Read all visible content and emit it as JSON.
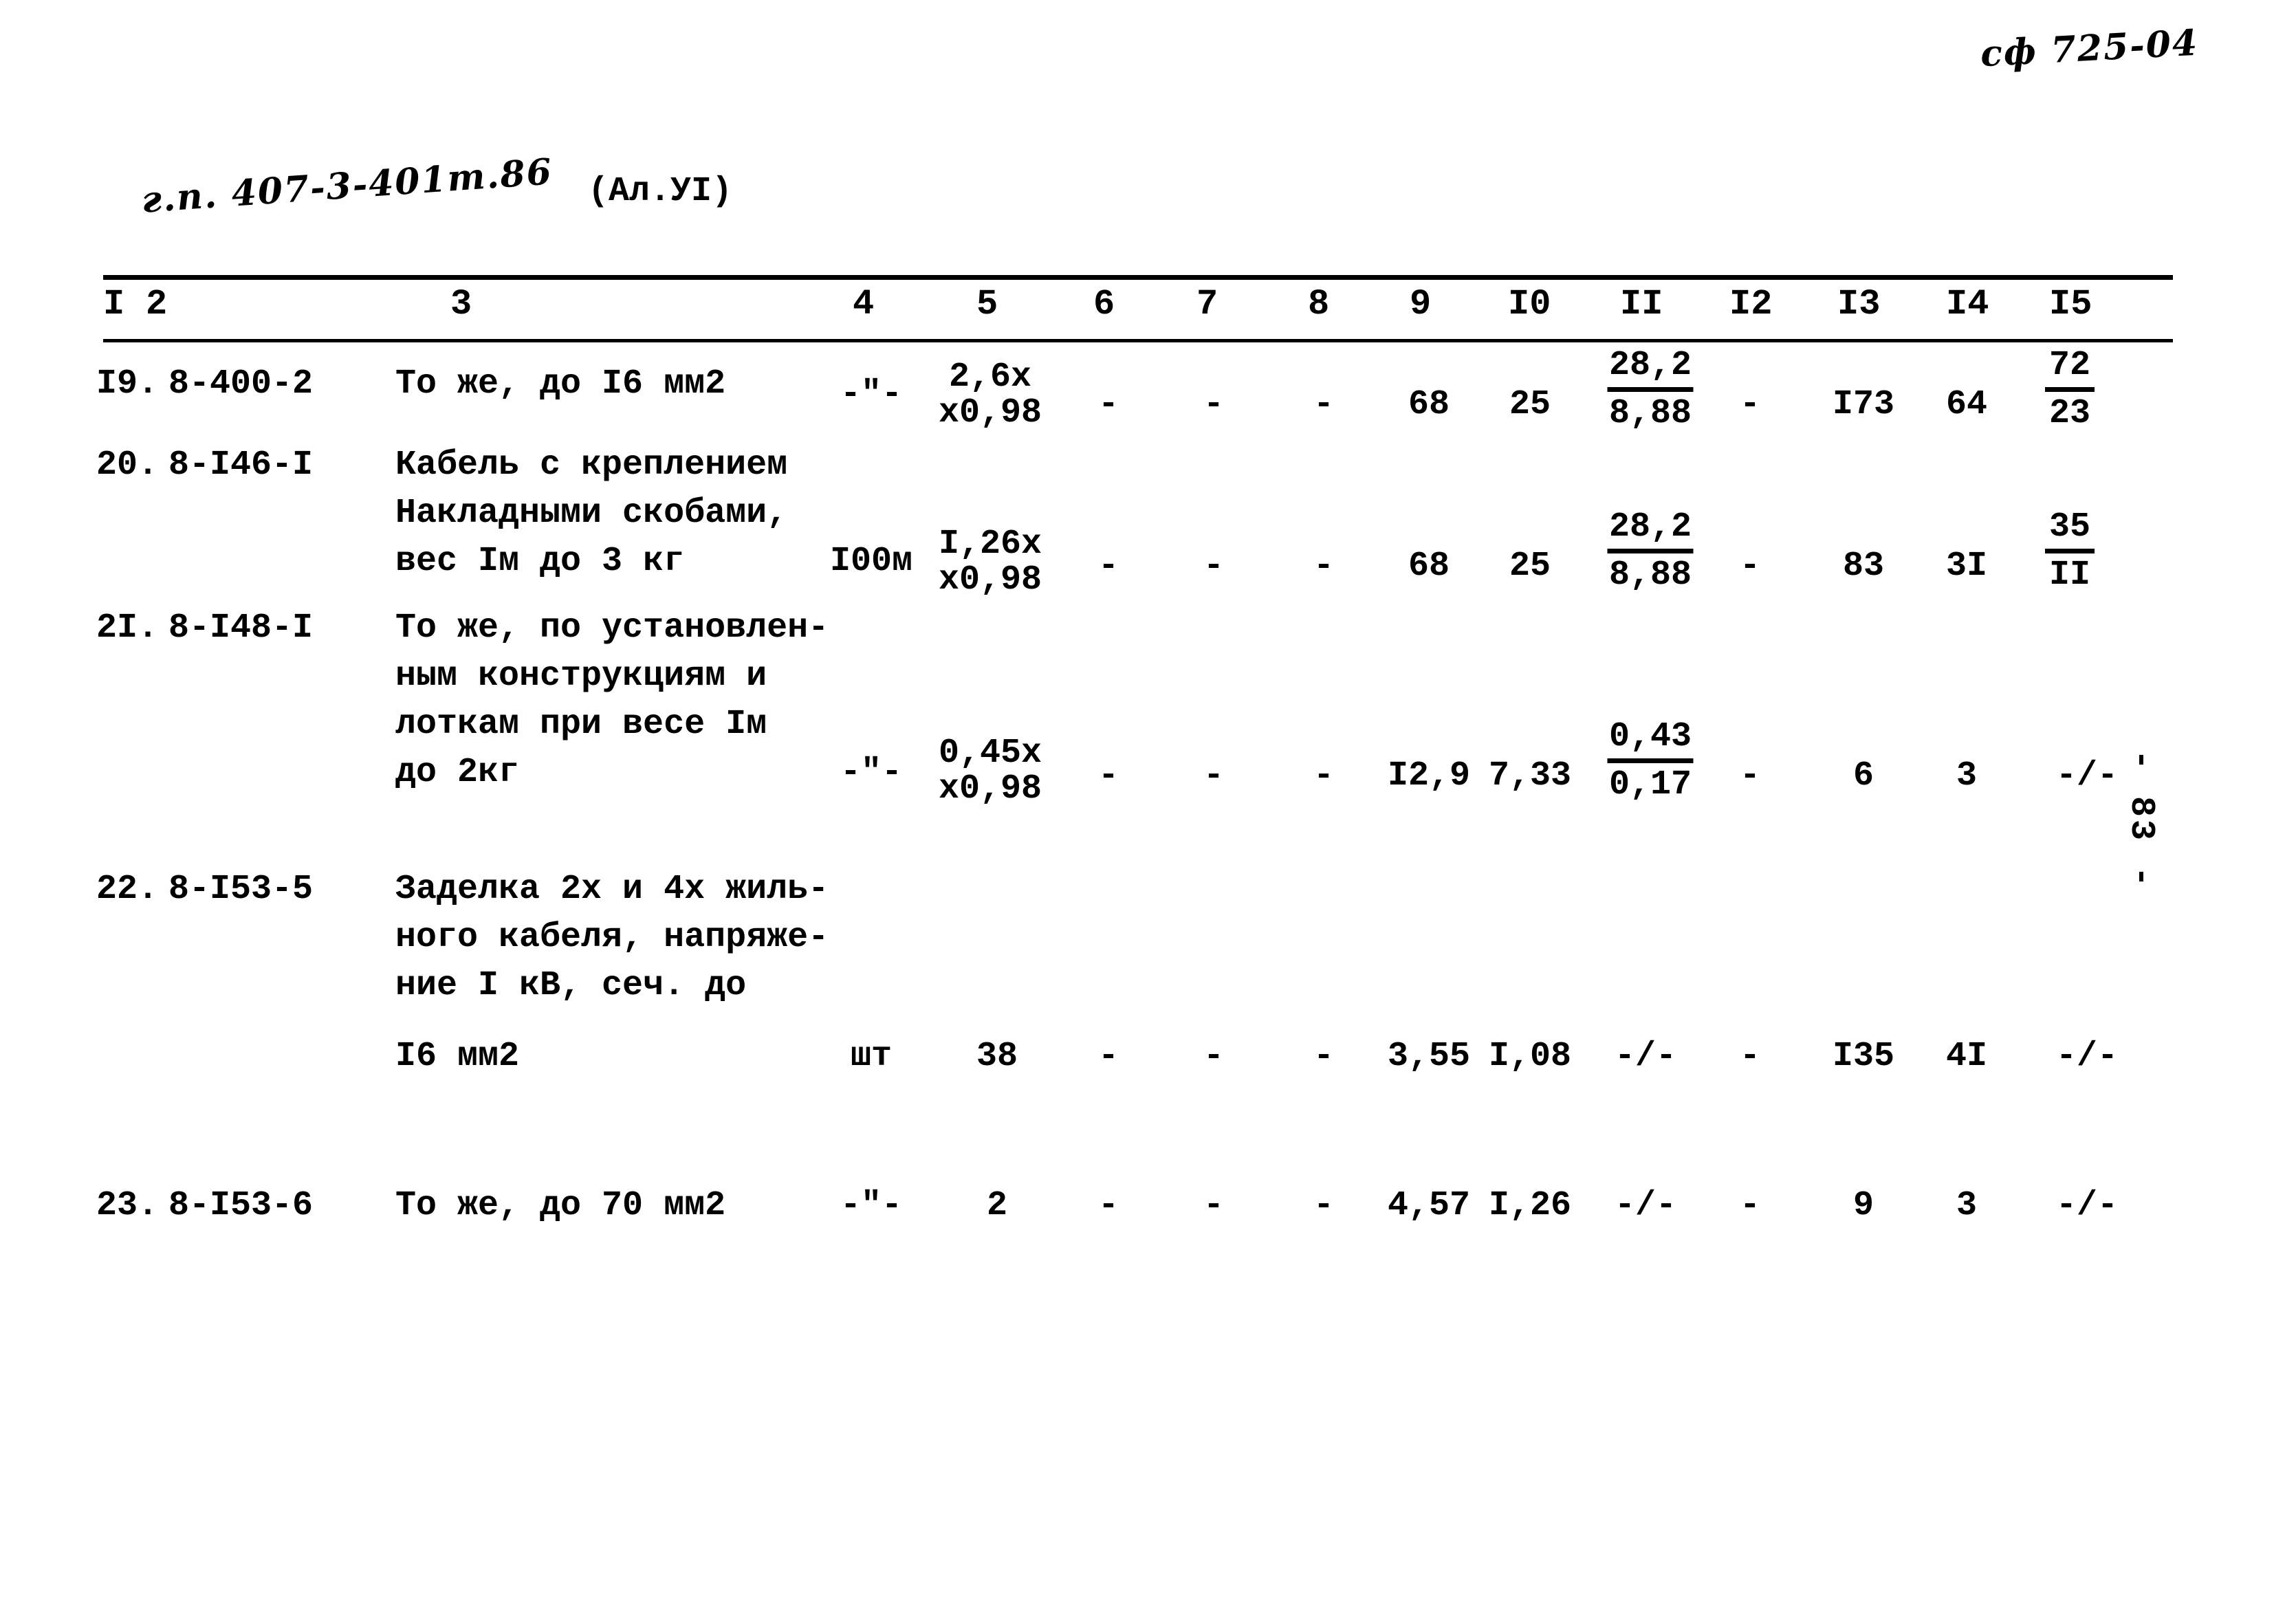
{
  "annotations": {
    "top_right_code": "сф 725-04",
    "project_code": "г.п. 407-3-401т.86",
    "album_label": "(Ал.УI)",
    "page_marker": "- 83 -"
  },
  "table": {
    "column_headers": [
      "I",
      "2",
      "3",
      "4",
      "5",
      "6",
      "7",
      "8",
      "9",
      "I0",
      "II",
      "I2",
      "I3",
      "I4",
      "I5"
    ],
    "rows": [
      {
        "no": "I9.",
        "code": "8-400-2",
        "description": [
          "То же, до I6 мм2"
        ],
        "unit": "-\"-",
        "qty_top": "2,6х",
        "qty_bottom": "х0,98",
        "c6": "-",
        "c7": "-",
        "c8": "-",
        "c9": "68",
        "c10": "25",
        "c11_num": "28,2",
        "c11_den": "8,88",
        "c12": "-",
        "c13": "I73",
        "c14": "64",
        "c15_num": "72",
        "c15_den": "23"
      },
      {
        "no": "20.",
        "code": "8-I46-I",
        "description": [
          "Кабель с креплением",
          "Накладными скобами,",
          "вес Iм до 3 кг"
        ],
        "unit": "I00м",
        "qty_top": "I,26х",
        "qty_bottom": "х0,98",
        "c6": "-",
        "c7": "-",
        "c8": "-",
        "c9": "68",
        "c10": "25",
        "c11_num": "28,2",
        "c11_den": "8,88",
        "c12": "-",
        "c13": "83",
        "c14": "3I",
        "c15_num": "35",
        "c15_den": "II"
      },
      {
        "no": "2I.",
        "code": "8-I48-I",
        "description": [
          "То же, по установлен-",
          "ным конструкциям и",
          "лоткам при весе Iм",
          "до 2кг"
        ],
        "unit": "-\"-",
        "qty_top": "0,45х",
        "qty_bottom": "х0,98",
        "c6": "-",
        "c7": "-",
        "c8": "-",
        "c9": "I2,9",
        "c10": "7,33",
        "c11_num": "0,43",
        "c11_den": "0,17",
        "c12": "-",
        "c13": "6",
        "c14": "3",
        "c15": "-/-"
      },
      {
        "no": "22.",
        "code": "8-I53-5",
        "description": [
          "Заделка 2х и 4х жиль-",
          "ного кабеля, напряже-",
          "ние I кВ, сеч. до",
          "I6 мм2"
        ],
        "unit": "шт",
        "qty": "38",
        "c6": "-",
        "c7": "-",
        "c8": "-",
        "c9": "3,55",
        "c10": "I,08",
        "c11": "-/-",
        "c12": "-",
        "c13": "I35",
        "c14": "4I",
        "c15": "-/-"
      },
      {
        "no": "23.",
        "code": "8-I53-6",
        "description": [
          "То же, до 70 мм2"
        ],
        "unit": "-\"-",
        "qty": "2",
        "c6": "-",
        "c7": "-",
        "c8": "-",
        "c9": "4,57",
        "c10": "I,26",
        "c11": "-/-",
        "c12": "-",
        "c13": "9",
        "c14": "3",
        "c15": "-/-"
      }
    ]
  }
}
